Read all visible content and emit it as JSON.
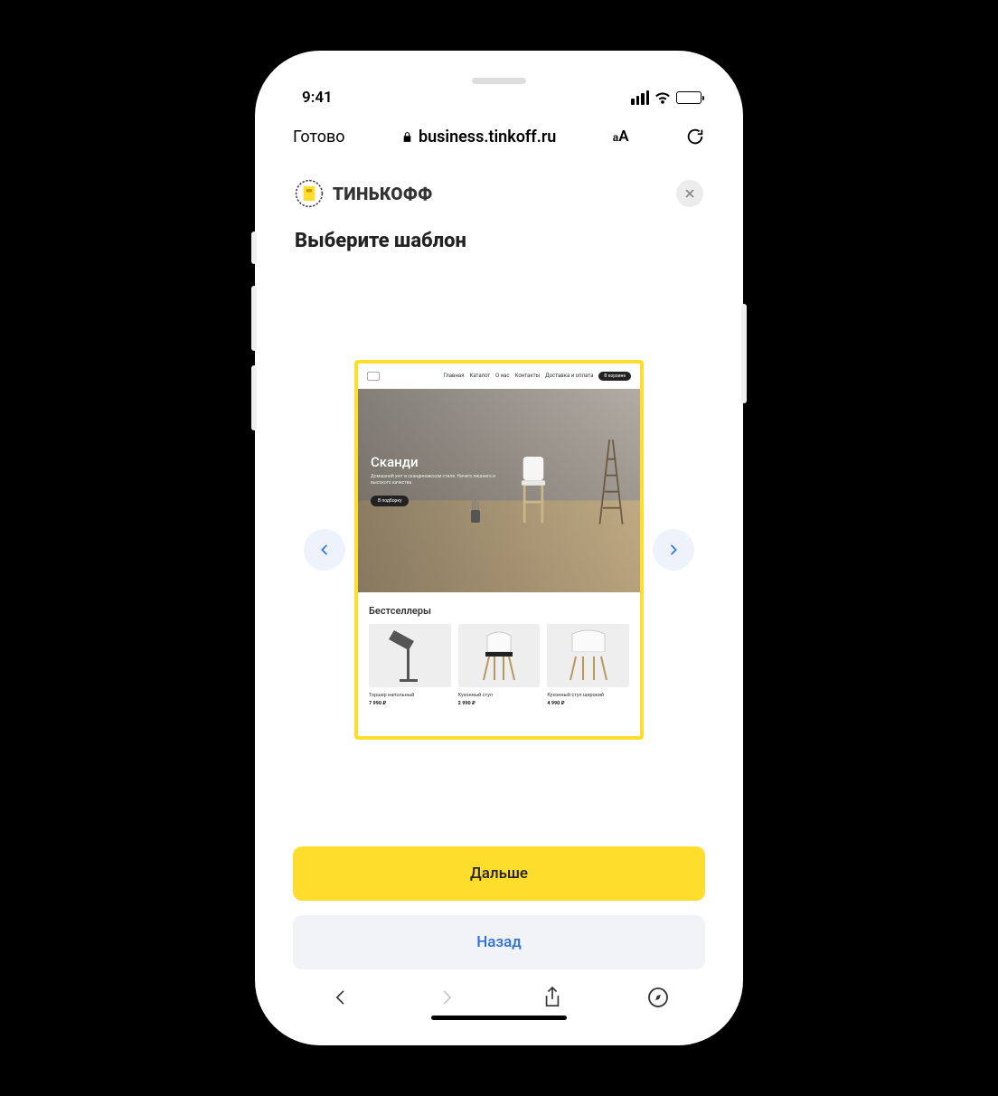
{
  "status": {
    "time": "9:41"
  },
  "browser": {
    "done_label": "Готово",
    "url": "business.tinkoff.ru",
    "text_size_label": "aA"
  },
  "app": {
    "brand": "ТИНЬКОФФ",
    "page_title": "Выберите шаблон",
    "next_label": "Дальше",
    "back_label": "Назад"
  },
  "template": {
    "nav_items": [
      "Главная",
      "Каталог",
      "О нас",
      "Контакты",
      "Доставка и оплата"
    ],
    "nav_cta": "В корзине",
    "hero_title": "Сканди",
    "hero_sub": "Домашний уют в скандинавском стиле. Ничего лишнего и высокого качества",
    "hero_cta": "В подборку",
    "section_title": "Бестселлеры",
    "products": [
      {
        "name": "Торшер напольный",
        "price": "7 990 ₽"
      },
      {
        "name": "Кухонный стул",
        "price": "2 990 ₽"
      },
      {
        "name": "Кухонный стул широкий",
        "price": "4 990 ₽"
      }
    ]
  }
}
